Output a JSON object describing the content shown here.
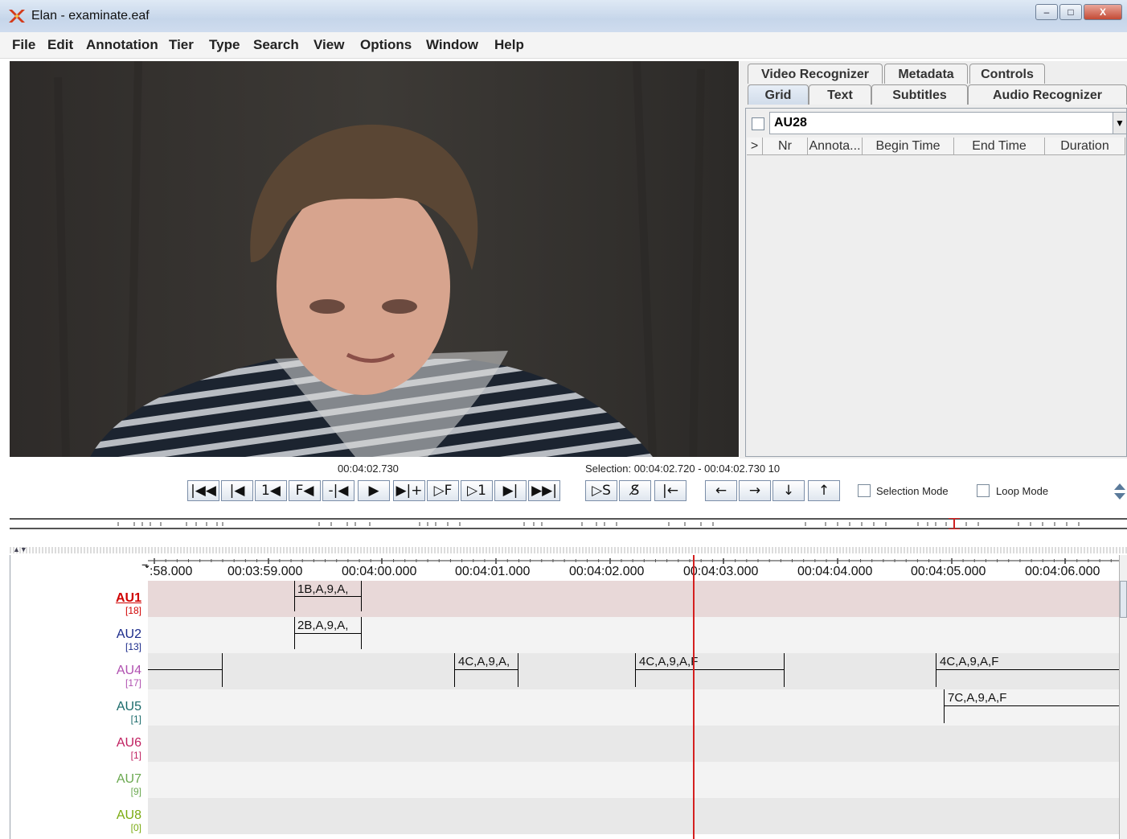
{
  "window": {
    "title": "Elan - examinate.eaf",
    "min_icon": "–",
    "max_icon": "□",
    "close_icon": "X"
  },
  "menu": [
    "File",
    "Edit",
    "Annotation",
    "Tier",
    "Type",
    "Search",
    "View",
    "Options",
    "Window",
    "Help"
  ],
  "tabs_top": [
    "Video Recognizer",
    "Metadata",
    "Controls"
  ],
  "tabs_bottom": [
    "Grid",
    "Text",
    "Subtitles",
    "Audio Recognizer"
  ],
  "grid": {
    "tier": "AU28",
    "columns": [
      ">",
      "Nr",
      "Annota...",
      "Begin Time",
      "End Time",
      "Duration"
    ]
  },
  "media": {
    "current_time": "00:04:02.730",
    "selection": "Selection: 00:04:02.720 - 00:04:02.730  10",
    "buttons": [
      "|◀◀",
      "|◀",
      "1◀",
      "F◀",
      "-|◀",
      "▶",
      "▶|+",
      "▷F",
      "▷1",
      "▶|",
      "▶▶|"
    ],
    "sel_buttons": [
      "▷S",
      "S̸",
      "|←"
    ],
    "nav_buttons": [
      "←",
      "→",
      "↓",
      "↑"
    ],
    "selection_mode": "Selection Mode",
    "loop_mode": "Loop Mode"
  },
  "timeline": {
    "tick_labels": [
      ":58.000",
      "00:03:59.000",
      "00:04:00.000",
      "00:04:01.000",
      "00:04:02.000",
      "00:04:03.000",
      "00:04:04.000",
      "00:04:05.000",
      "00:04:06.000"
    ],
    "tiers": [
      {
        "name": "AU1",
        "count": "[18]",
        "color": "#d00000"
      },
      {
        "name": "AU2",
        "count": "[13]",
        "color": "#1a2a8a"
      },
      {
        "name": "AU4",
        "count": "[17]",
        "color": "#b050b0"
      },
      {
        "name": "AU5",
        "count": "[1]",
        "color": "#1a6a6a"
      },
      {
        "name": "AU6",
        "count": "[1]",
        "color": "#c02060"
      },
      {
        "name": "AU7",
        "count": "[9]",
        "color": "#6aa84f"
      },
      {
        "name": "AU8",
        "count": "[0]",
        "color": "#7aaa10"
      }
    ],
    "annotations": {
      "au1": "1B,A,9,A,",
      "au2": "2B,A,9,A,",
      "au4_a": "4C,A,9,A,",
      "au4_b": "4C,A,9,A,F",
      "au4_c": "4C,A,9,A,F",
      "au5": "7C,A,9,A,F"
    }
  }
}
